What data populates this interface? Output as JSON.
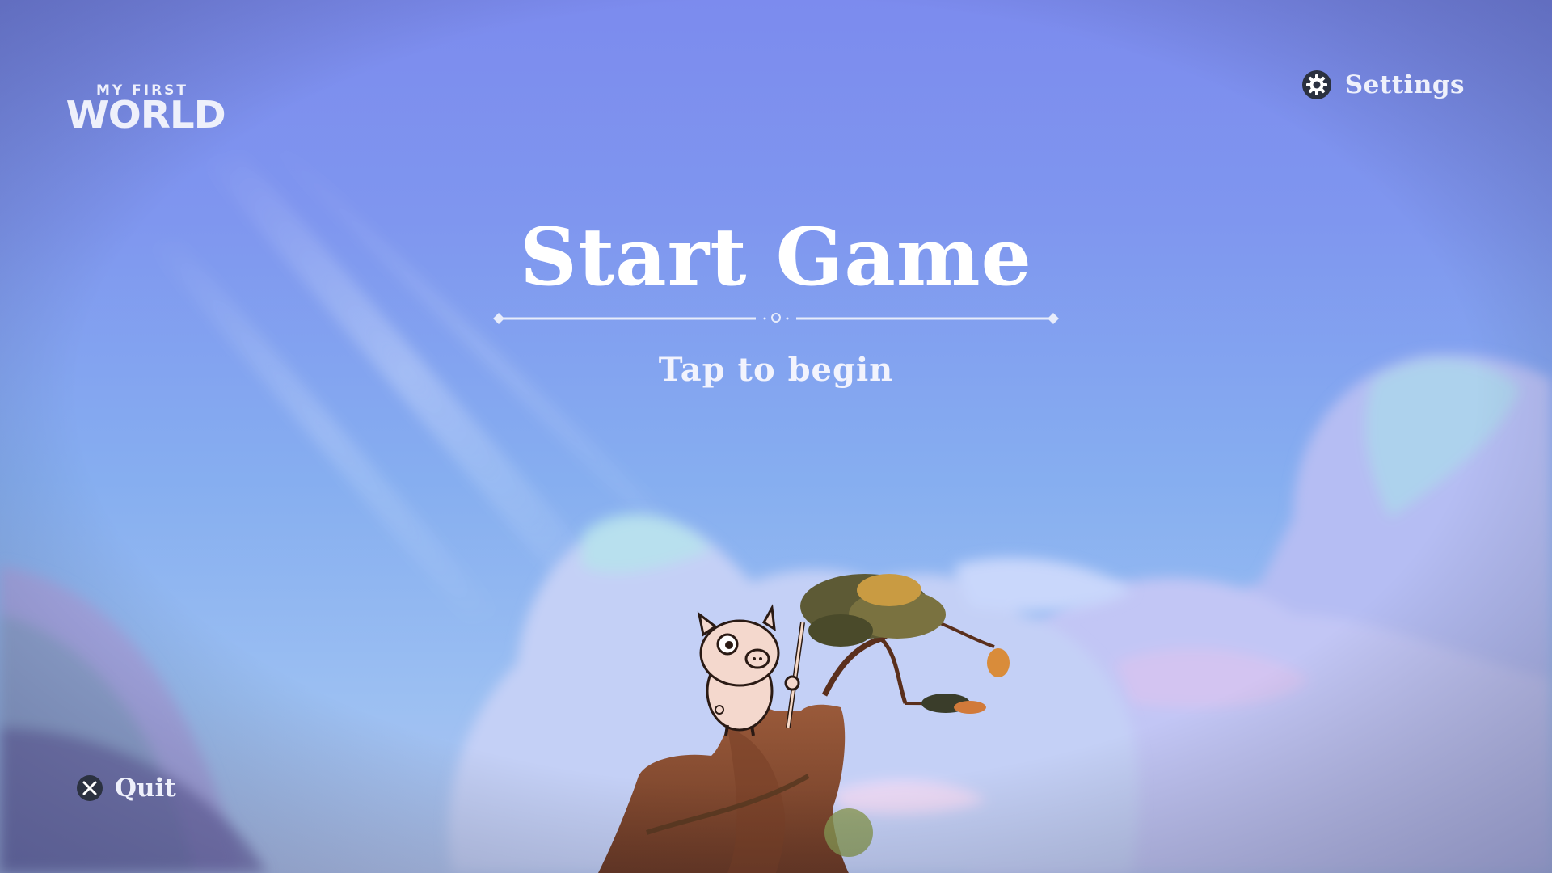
{
  "logo": {
    "line1": "MY FIRST",
    "line2": "WORLD"
  },
  "header": {
    "settings_label": "Settings",
    "settings_icon": "gear-icon"
  },
  "menu": {
    "title": "Start Game",
    "subtitle": "Tap to begin"
  },
  "footer": {
    "quit_label": "Quit",
    "quit_icon": "cross-button-icon"
  },
  "colors": {
    "sky_top": "#7c8bee",
    "sky_bottom": "#b3c6f0",
    "text": "#ffffff",
    "button_icon": "#2b3140"
  }
}
